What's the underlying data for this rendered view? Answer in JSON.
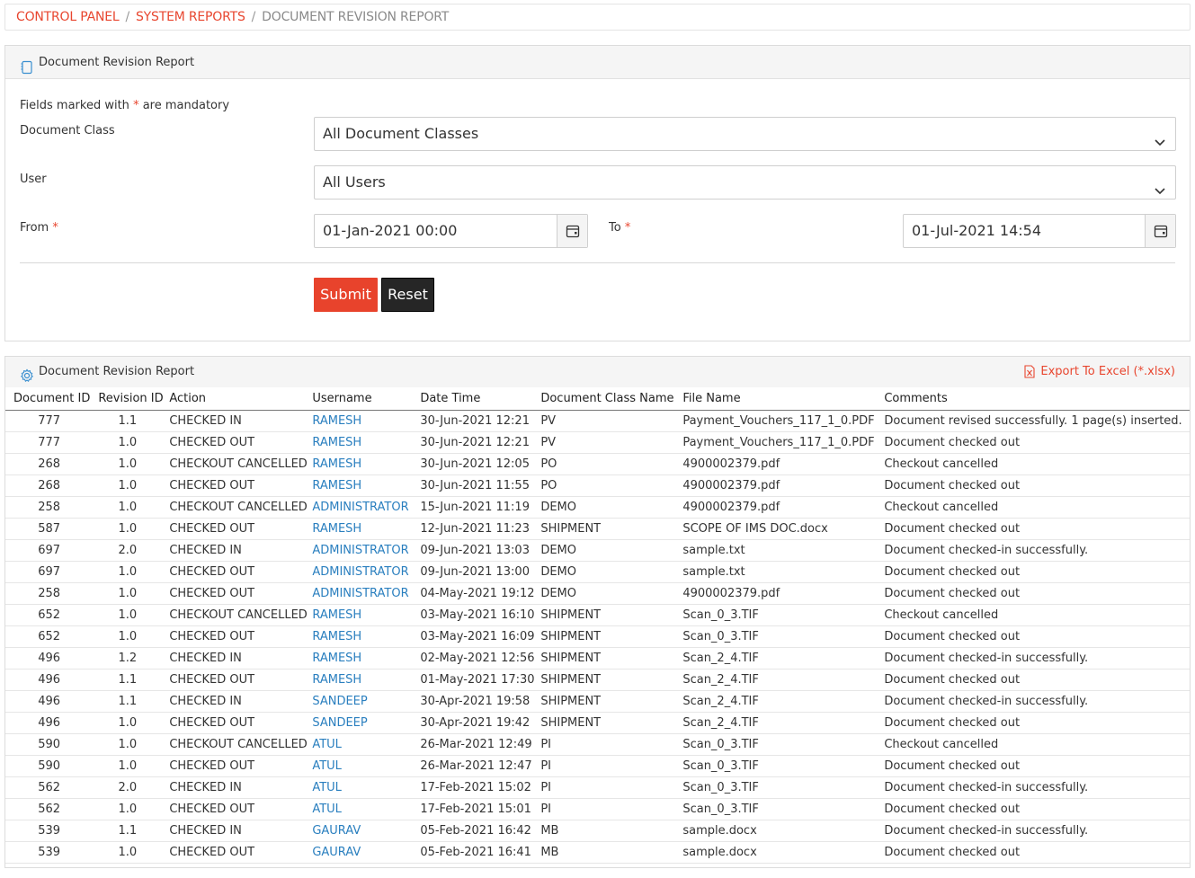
{
  "breadcrumb": {
    "items": [
      "CONTROL PANEL",
      "SYSTEM REPORTS"
    ],
    "separator": "/",
    "current": "DOCUMENT REVISION REPORT"
  },
  "form_panel": {
    "title": "Document Revision Report",
    "mandatory_note_prefix": "Fields marked with",
    "mandatory_star": "*",
    "mandatory_note_suffix": "are mandatory",
    "document_class_label": "Document Class",
    "document_class_value": "All Document Classes",
    "user_label": "User",
    "user_value": "All Users",
    "from_label": "From",
    "from_value": "01-Jan-2021 00:00",
    "to_label": "To",
    "to_value": "01-Jul-2021 14:54",
    "submit_label": "Submit",
    "reset_label": "Reset"
  },
  "report_panel": {
    "title": "Document Revision Report",
    "export_label": "Export To Excel (*.xlsx)",
    "columns": [
      "Document ID",
      "Revision ID",
      "Action",
      "Username",
      "Date Time",
      "Document Class Name",
      "File Name",
      "Comments"
    ],
    "rows": [
      [
        "777",
        "1.1",
        "CHECKED IN",
        "RAMESH",
        "30-Jun-2021 12:21",
        "PV",
        "Payment_Vouchers_117_1_0.PDF",
        "Document revised successfully. 1 page(s) inserted."
      ],
      [
        "777",
        "1.0",
        "CHECKED OUT",
        "RAMESH",
        "30-Jun-2021 12:21",
        "PV",
        "Payment_Vouchers_117_1_0.PDF",
        "Document checked out"
      ],
      [
        "268",
        "1.0",
        "CHECKOUT CANCELLED",
        "RAMESH",
        "30-Jun-2021 12:05",
        "PO",
        "4900002379.pdf",
        "Checkout cancelled"
      ],
      [
        "268",
        "1.0",
        "CHECKED OUT",
        "RAMESH",
        "30-Jun-2021 11:55",
        "PO",
        "4900002379.pdf",
        "Document checked out"
      ],
      [
        "258",
        "1.0",
        "CHECKOUT CANCELLED",
        "ADMINISTRATOR",
        "15-Jun-2021 11:19",
        "DEMO",
        "4900002379.pdf",
        "Checkout cancelled"
      ],
      [
        "587",
        "1.0",
        "CHECKED OUT",
        "RAMESH",
        "12-Jun-2021 11:23",
        "SHIPMENT",
        "SCOPE OF IMS DOC.docx",
        "Document checked out"
      ],
      [
        "697",
        "2.0",
        "CHECKED IN",
        "ADMINISTRATOR",
        "09-Jun-2021 13:03",
        "DEMO",
        "sample.txt",
        "Document checked-in successfully."
      ],
      [
        "697",
        "1.0",
        "CHECKED OUT",
        "ADMINISTRATOR",
        "09-Jun-2021 13:00",
        "DEMO",
        "sample.txt",
        "Document checked out"
      ],
      [
        "258",
        "1.0",
        "CHECKED OUT",
        "ADMINISTRATOR",
        "04-May-2021 19:12",
        "DEMO",
        "4900002379.pdf",
        "Document checked out"
      ],
      [
        "652",
        "1.0",
        "CHECKOUT CANCELLED",
        "RAMESH",
        "03-May-2021 16:10",
        "SHIPMENT",
        "Scan_0_3.TIF",
        "Checkout cancelled"
      ],
      [
        "652",
        "1.0",
        "CHECKED OUT",
        "RAMESH",
        "03-May-2021 16:09",
        "SHIPMENT",
        "Scan_0_3.TIF",
        "Document checked out"
      ],
      [
        "496",
        "1.2",
        "CHECKED IN",
        "RAMESH",
        "02-May-2021 12:56",
        "SHIPMENT",
        "Scan_2_4.TIF",
        "Document checked-in successfully."
      ],
      [
        "496",
        "1.1",
        "CHECKED OUT",
        "RAMESH",
        "01-May-2021 17:30",
        "SHIPMENT",
        "Scan_2_4.TIF",
        "Document checked out"
      ],
      [
        "496",
        "1.1",
        "CHECKED IN",
        "SANDEEP",
        "30-Apr-2021 19:58",
        "SHIPMENT",
        "Scan_2_4.TIF",
        "Document checked-in successfully."
      ],
      [
        "496",
        "1.0",
        "CHECKED OUT",
        "SANDEEP",
        "30-Apr-2021 19:42",
        "SHIPMENT",
        "Scan_2_4.TIF",
        "Document checked out"
      ],
      [
        "590",
        "1.0",
        "CHECKOUT CANCELLED",
        "ATUL",
        "26-Mar-2021 12:49",
        "PI",
        "Scan_0_3.TIF",
        "Checkout cancelled"
      ],
      [
        "590",
        "1.0",
        "CHECKED OUT",
        "ATUL",
        "26-Mar-2021 12:47",
        "PI",
        "Scan_0_3.TIF",
        "Document checked out"
      ],
      [
        "562",
        "2.0",
        "CHECKED IN",
        "ATUL",
        "17-Feb-2021 15:02",
        "PI",
        "Scan_0_3.TIF",
        "Document checked-in successfully."
      ],
      [
        "562",
        "1.0",
        "CHECKED OUT",
        "ATUL",
        "17-Feb-2021 15:01",
        "PI",
        "Scan_0_3.TIF",
        "Document checked out"
      ],
      [
        "539",
        "1.1",
        "CHECKED IN",
        "GAURAV",
        "05-Feb-2021 16:42",
        "MB",
        "sample.docx",
        "Document checked-in successfully."
      ],
      [
        "539",
        "1.0",
        "CHECKED OUT",
        "GAURAV",
        "05-Feb-2021 16:41",
        "MB",
        "sample.docx",
        "Document checked out"
      ]
    ]
  },
  "colors": {
    "accent": "#e8462f",
    "link": "#2a7fbf",
    "reset_button": "#262626"
  },
  "icons": [
    "document-icon",
    "chevron-down-icon",
    "calendar-icon",
    "gear-icon",
    "excel-file-icon"
  ]
}
